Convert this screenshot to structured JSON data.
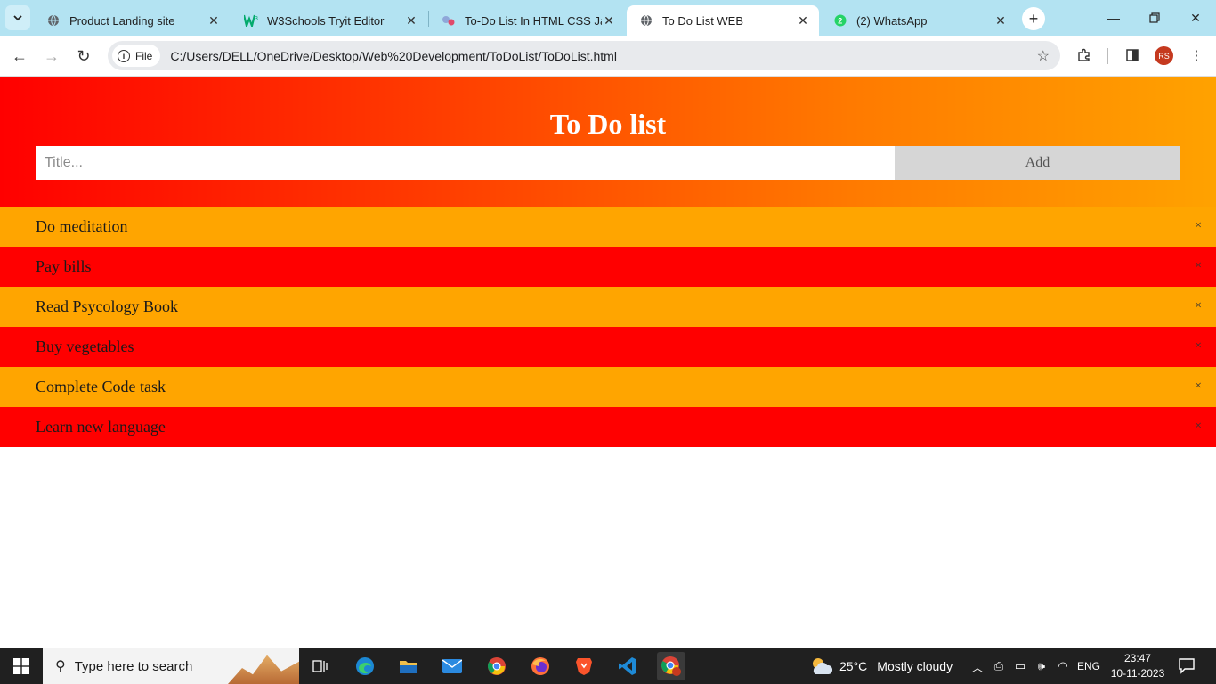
{
  "browser": {
    "tabs": [
      {
        "title": "Product Landing site"
      },
      {
        "title": "W3Schools Tryit Editor"
      },
      {
        "title": "To-Do List In HTML CSS Jav"
      },
      {
        "title": "To Do List WEB",
        "active": true
      },
      {
        "title": "(2) WhatsApp"
      }
    ],
    "chip_label": "File",
    "url": "C:/Users/DELL/OneDrive/Desktop/Web%20Development/ToDoList/ToDoList.html",
    "profile_initials": "RS"
  },
  "app": {
    "title": "To Do list",
    "input_placeholder": "Title...",
    "add_label": "Add",
    "close_glyph": "×",
    "colors": {
      "odd": "#ffa500",
      "even": "#ff0000"
    },
    "todos": [
      {
        "text": "Do meditation"
      },
      {
        "text": "Pay bills"
      },
      {
        "text": "Read Psycology Book"
      },
      {
        "text": "Buy vegetables"
      },
      {
        "text": "Complete Code task"
      },
      {
        "text": "Learn new language"
      }
    ]
  },
  "taskbar": {
    "search_placeholder": "Type here to search",
    "weather_temp": "25°C",
    "weather_desc": "Mostly cloudy",
    "language": "ENG",
    "time": "23:47",
    "date": "10-11-2023"
  }
}
